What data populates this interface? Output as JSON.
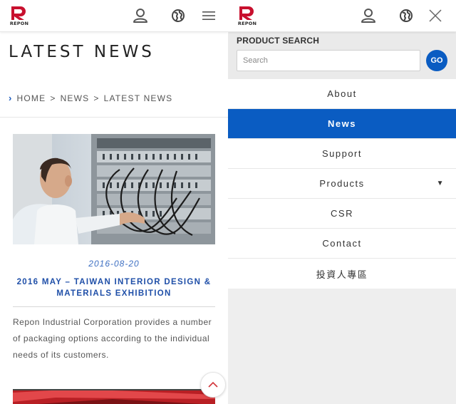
{
  "brand": {
    "logo_text": "REPON",
    "accent": "#0a5cc2",
    "logo_red": "#c8102e"
  },
  "left": {
    "header": {
      "icons": [
        "user-icon",
        "globe-icon",
        "hamburger-icon"
      ]
    },
    "page_title": "LATEST NEWS",
    "breadcrumb": {
      "home": "HOME",
      "sep1": ">",
      "news": "NEWS",
      "sep2": ">",
      "current": "LATEST NEWS"
    },
    "article": {
      "date": "2016-08-20",
      "title": "2016 MAY – TAIWAN INTERIOR DESIGN & MATERIALS EXHIBITION",
      "description": "Repon Industrial Corporation provides a number of packaging options according to the individual needs of its customers."
    },
    "back_to_top_icon": "chevron-up-icon"
  },
  "right": {
    "header": {
      "icons": [
        "user-icon",
        "globe-icon",
        "close-icon"
      ]
    },
    "product_search": {
      "label": "PRODUCT SEARCH",
      "placeholder": "Search",
      "go_label": "GO"
    },
    "menu": [
      {
        "label": "About",
        "active": false
      },
      {
        "label": "News",
        "active": true
      },
      {
        "label": "Support",
        "active": false
      },
      {
        "label": "Products",
        "active": false,
        "caret": "▼"
      },
      {
        "label": "CSR",
        "active": false
      },
      {
        "label": "Contact",
        "active": false
      },
      {
        "label": "投資人專區",
        "active": false
      }
    ]
  }
}
